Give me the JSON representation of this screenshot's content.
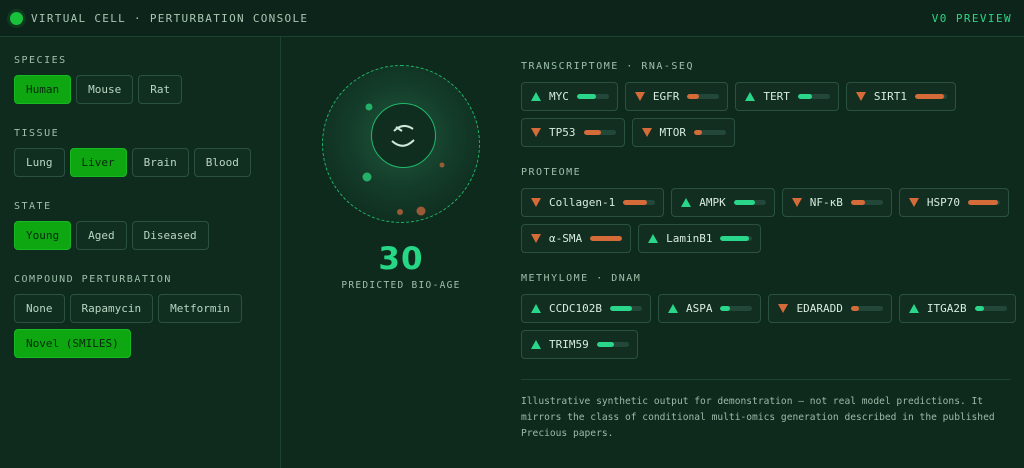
{
  "header": {
    "title": "VIRTUAL CELL · PERTURBATION CONSOLE",
    "badge": "V0 PREVIEW"
  },
  "left": {
    "species": {
      "title": "SPECIES",
      "options": [
        "Human",
        "Mouse",
        "Rat"
      ],
      "selected": "Human"
    },
    "tissue": {
      "title": "TISSUE",
      "options": [
        "Lung",
        "Liver",
        "Brain",
        "Blood"
      ],
      "selected": "Liver"
    },
    "state": {
      "title": "STATE",
      "options": [
        "Young",
        "Aged",
        "Diseased"
      ],
      "selected": "Young"
    },
    "compound": {
      "title": "COMPOUND PERTURBATION",
      "options": [
        "None",
        "Rapamycin",
        "Metformin",
        "Novel (SMILES)"
      ],
      "selected": "Novel (SMILES)"
    }
  },
  "center": {
    "bioage_value": "30",
    "bioage_label": "PREDICTED BIO-AGE"
  },
  "omics": {
    "transcriptome": {
      "title": "TRANSCRIPTOME · RNA-SEQ",
      "genes": [
        {
          "name": "MYC",
          "dir": "up",
          "level": 0.6
        },
        {
          "name": "EGFR",
          "dir": "down",
          "level": 0.35
        },
        {
          "name": "TERT",
          "dir": "up",
          "level": 0.45
        },
        {
          "name": "SIRT1",
          "dir": "down",
          "level": 0.9
        },
        {
          "name": "TP53",
          "dir": "down",
          "level": 0.55
        },
        {
          "name": "MTOR",
          "dir": "down",
          "level": 0.25
        }
      ]
    },
    "proteome": {
      "title": "PROTEOME",
      "genes": [
        {
          "name": "Collagen-1",
          "dir": "down",
          "level": 0.75
        },
        {
          "name": "AMPK",
          "dir": "up",
          "level": 0.65
        },
        {
          "name": "NF-κB",
          "dir": "down",
          "level": 0.45
        },
        {
          "name": "HSP70",
          "dir": "down",
          "level": 0.95
        },
        {
          "name": "α-SMA",
          "dir": "down",
          "level": 1.0
        },
        {
          "name": "LaminB1",
          "dir": "up",
          "level": 0.9
        }
      ]
    },
    "methylome": {
      "title": "METHYLOME · DNAM",
      "genes": [
        {
          "name": "CCDC102B",
          "dir": "up",
          "level": 0.7
        },
        {
          "name": "ASPA",
          "dir": "up",
          "level": 0.3
        },
        {
          "name": "EDARADD",
          "dir": "down",
          "level": 0.25
        },
        {
          "name": "ITGA2B",
          "dir": "up",
          "level": 0.3
        },
        {
          "name": "TRIM59",
          "dir": "up",
          "level": 0.55
        }
      ]
    }
  },
  "footer_note": "Illustrative synthetic output for demonstration — not real model predictions. It mirrors the class of conditional multi-omics generation described in the published Precious papers.",
  "colors": {
    "accent": "#0ea611",
    "up": "#2ad68a",
    "down": "#d66b3a"
  }
}
